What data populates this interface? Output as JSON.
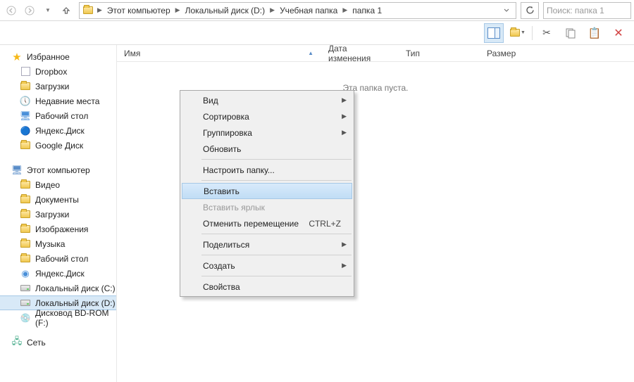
{
  "breadcrumbs": {
    "items": [
      "Этот компьютер",
      "Локальный диск (D:)",
      "Учебная папка",
      "папка 1"
    ]
  },
  "search": {
    "placeholder": "Поиск: папка 1"
  },
  "columns": {
    "name": "Имя",
    "date": "Дата изменения",
    "type": "Тип",
    "size": "Размер"
  },
  "content": {
    "empty": "Эта папка пуста."
  },
  "sidebar": {
    "favorites": {
      "label": "Избранное",
      "items": [
        "Dropbox",
        "Загрузки",
        "Недавние места",
        "Рабочий стол",
        "Яндекс.Диск",
        "Google Диск"
      ]
    },
    "pc": {
      "label": "Этот компьютер",
      "items": [
        "Видео",
        "Документы",
        "Загрузки",
        "Изображения",
        "Музыка",
        "Рабочий стол",
        "Яндекс.Диск",
        "Локальный диск (C:)",
        "Локальный диск (D:)",
        "Дисковод BD-ROM (F:)"
      ]
    },
    "network": {
      "label": "Сеть"
    }
  },
  "contextMenu": {
    "view": "Вид",
    "sort": "Сортировка",
    "group": "Группировка",
    "refresh": "Обновить",
    "customize": "Настроить папку...",
    "paste": "Вставить",
    "pasteShortcut": "Вставить ярлык",
    "undoMove": "Отменить перемещение",
    "undoShortcut": "CTRL+Z",
    "share": "Поделиться",
    "create": "Создать",
    "properties": "Свойства"
  }
}
